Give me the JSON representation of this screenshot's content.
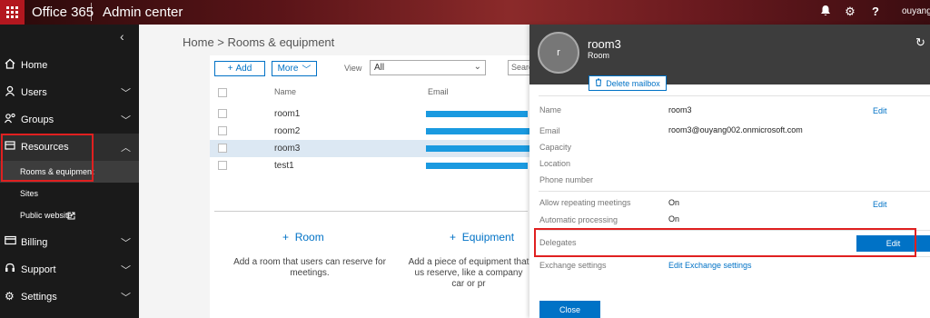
{
  "topbar": {
    "brand": "Office 365",
    "app": "Admin center",
    "user": "ouyangs"
  },
  "sidebar": {
    "collapse": "‹",
    "items": [
      {
        "label": "Home",
        "icon": "home-icon"
      },
      {
        "label": "Users",
        "icon": "user-icon"
      },
      {
        "label": "Groups",
        "icon": "group-icon"
      },
      {
        "label": "Resources",
        "icon": "resources-icon"
      },
      {
        "label": "Billing",
        "icon": "billing-icon"
      },
      {
        "label": "Support",
        "icon": "headset-icon"
      },
      {
        "label": "Settings",
        "icon": "gear-icon"
      }
    ],
    "sub_items": [
      {
        "label": "Rooms & equipment"
      },
      {
        "label": "Sites"
      },
      {
        "label": "Public website"
      }
    ]
  },
  "main": {
    "breadcrumb": "Home > Rooms & equipment",
    "toolbar": {
      "add": "Add",
      "more": "More",
      "view_label": "View",
      "view_value": "All",
      "search_placeholder": "Search"
    },
    "columns": {
      "name": "Name",
      "email": "Email"
    },
    "rows": [
      {
        "name": "room1",
        "selected": false
      },
      {
        "name": "room2",
        "selected": false
      },
      {
        "name": "room3",
        "selected": true
      },
      {
        "name": "test1",
        "selected": false
      }
    ],
    "add_room": {
      "label": "Room",
      "desc": "Add a room that users can reserve for meetings."
    },
    "add_equipment": {
      "label": "Equipment",
      "desc": "Add a piece of equipment that us reserve, like a company car or pr"
    }
  },
  "panel": {
    "avatar": "r",
    "title": "room3",
    "subtitle": "Room",
    "delete": "Delete mailbox",
    "fields": {
      "name_label": "Name",
      "name_value": "room3",
      "email_label": "Email",
      "email_value": "room3@ouyang002.onmicrosoft.com",
      "capacity_label": "Capacity",
      "location_label": "Location",
      "phone_label": "Phone number",
      "repeat_label": "Allow repeating meetings",
      "repeat_value": "On",
      "auto_label": "Automatic processing",
      "auto_value": "On",
      "delegates_label": "Delegates",
      "exchange_label": "Exchange settings",
      "exchange_link": "Edit Exchange settings"
    },
    "edit": "Edit",
    "close": "Close"
  },
  "colors": {
    "accent": "#0072c6",
    "highlight": "#e02020",
    "sidebar": "#1a1a1a"
  }
}
